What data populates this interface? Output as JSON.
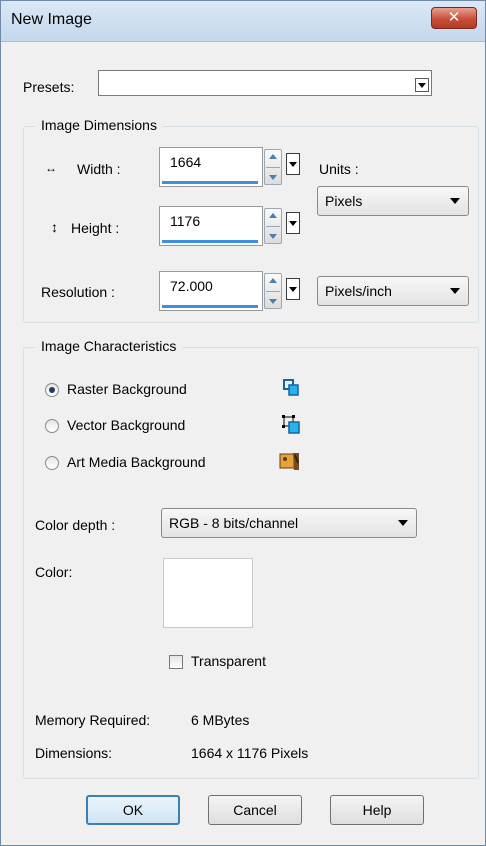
{
  "window": {
    "title": "New Image",
    "close_label": "✕"
  },
  "presets": {
    "label": "Presets:",
    "value": ""
  },
  "dimensions": {
    "group_title": "Image Dimensions",
    "width_label": "Width :",
    "width_value": "1664",
    "height_label": "Height :",
    "height_value": "1176",
    "resolution_label": "Resolution :",
    "resolution_value": "72.000",
    "units_label": "Units :",
    "units_value": "Pixels",
    "res_units_value": "Pixels/inch"
  },
  "characteristics": {
    "group_title": "Image Characteristics",
    "options": [
      {
        "label": "Raster Background",
        "selected": true
      },
      {
        "label": "Vector Background",
        "selected": false
      },
      {
        "label": "Art Media Background",
        "selected": false
      }
    ],
    "color_depth_label": "Color depth :",
    "color_depth_value": "RGB - 8 bits/channel",
    "color_label": "Color:",
    "color_value": "#ffffff",
    "transparent_label": "Transparent",
    "transparent_checked": false
  },
  "info": {
    "memory_label": "Memory Required:",
    "memory_value": "6 MBytes",
    "dimensions_label": "Dimensions:",
    "dimensions_value": "1664 x 1176 Pixels"
  },
  "buttons": {
    "ok": "OK",
    "cancel": "Cancel",
    "help": "Help"
  },
  "colors": {
    "accent": "#3f8fe0",
    "title_bar": "#c4d7ec",
    "close": "#c8503a"
  }
}
